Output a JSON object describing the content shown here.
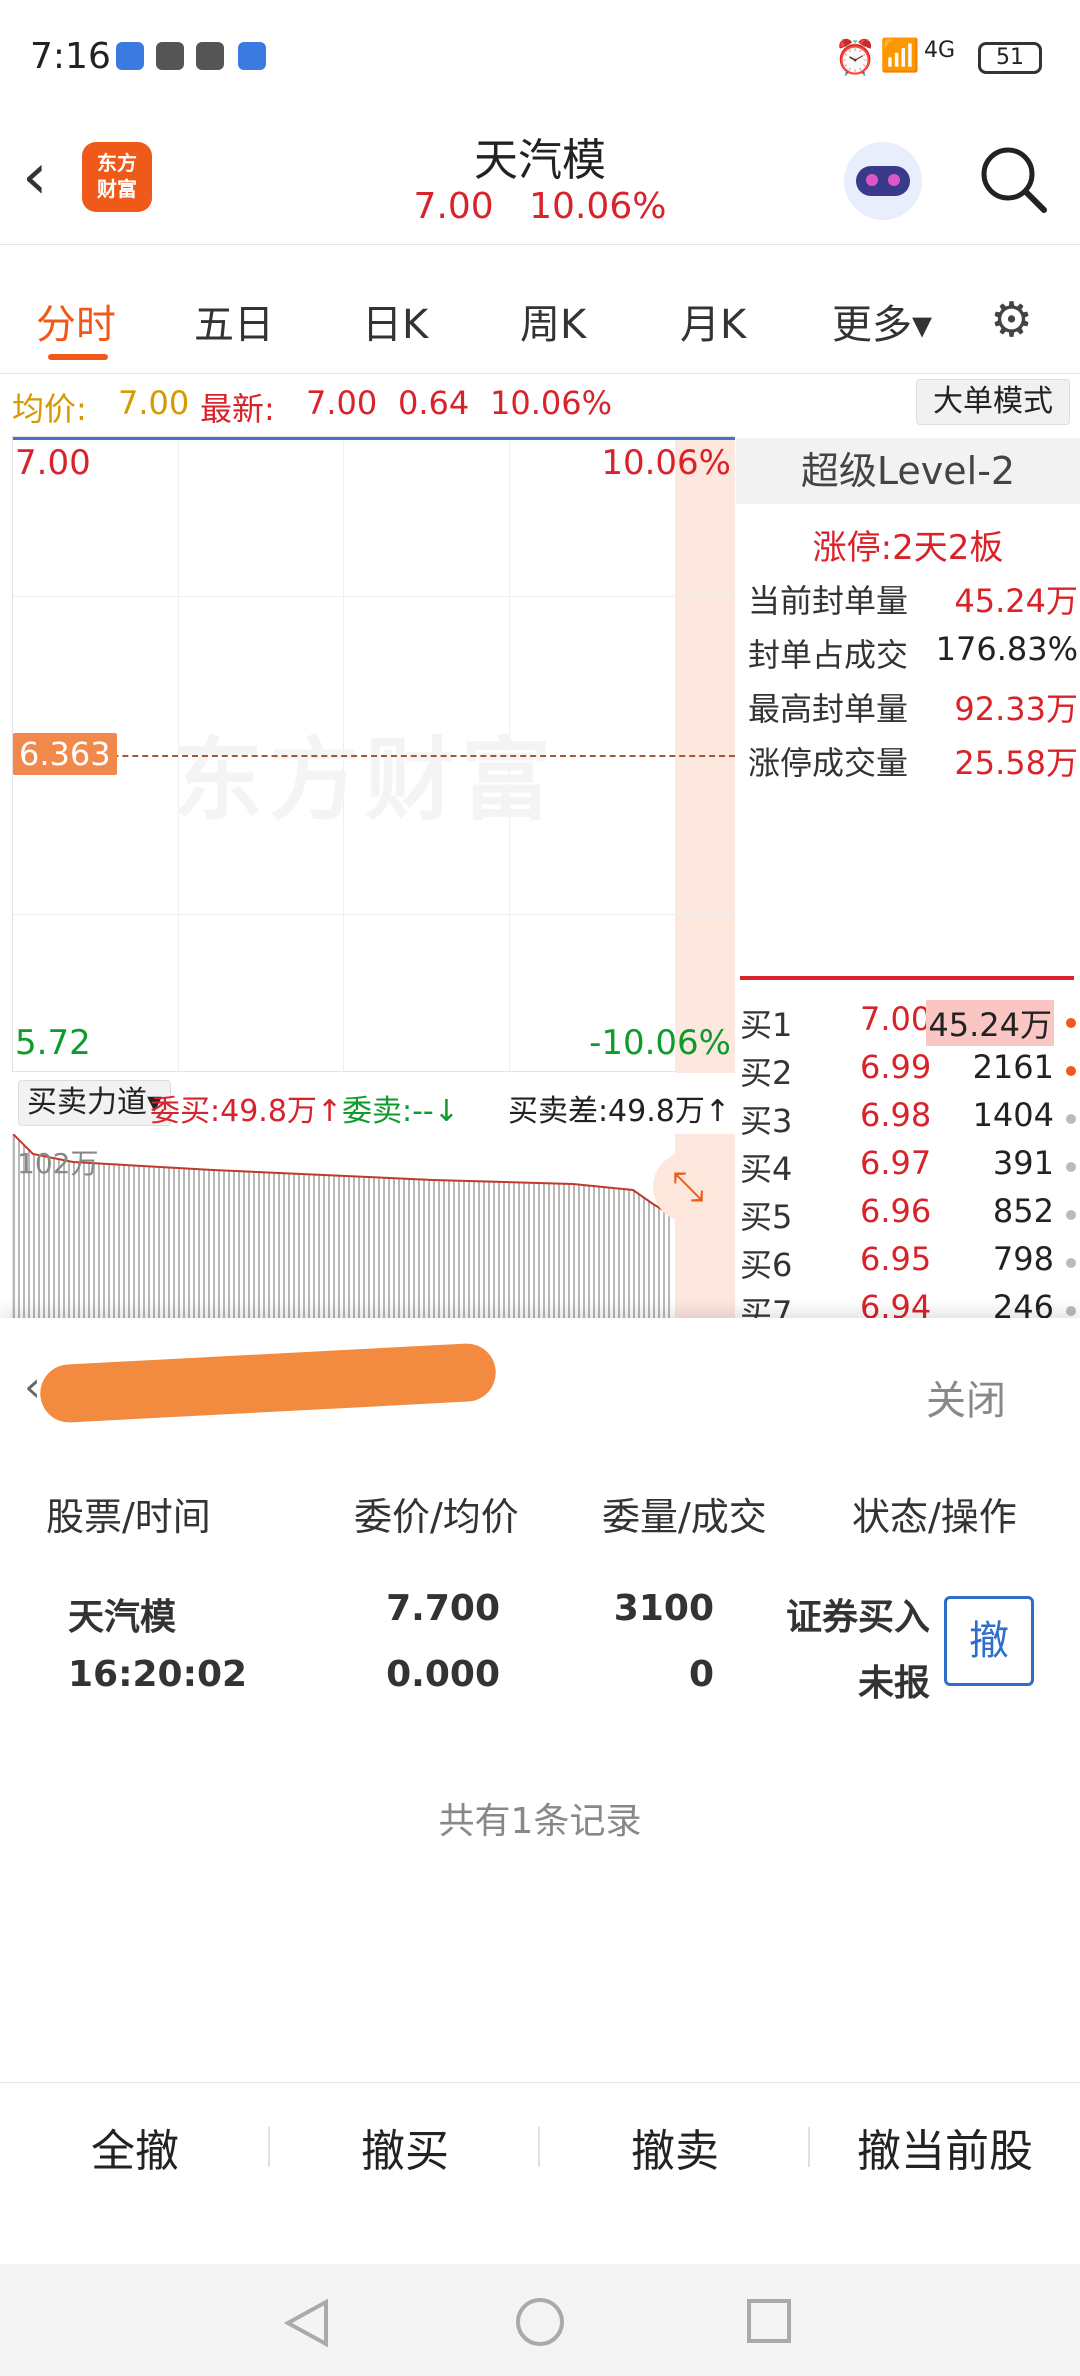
{
  "status": {
    "time": "7:16",
    "battery": "51",
    "net": "4G"
  },
  "header": {
    "title": "天汽模",
    "price": "7.00",
    "change_pct": "10.06%",
    "logo_line1": "东方",
    "logo_line2": "财富"
  },
  "tabs": [
    {
      "label": "分时"
    },
    {
      "label": "五日"
    },
    {
      "label": "日K"
    },
    {
      "label": "周K"
    },
    {
      "label": "月K"
    },
    {
      "label": "更多▾"
    }
  ],
  "info": {
    "avg_label": "均价:",
    "avg_value": "7.00",
    "latest_label": "最新:",
    "latest_value": "7.00",
    "change": "0.64",
    "change_pct": "10.06%",
    "mode_button": "大单模式"
  },
  "chart": {
    "top_price": "7.00",
    "top_pct": "10.06%",
    "mid_price": "6.363",
    "bottom_price": "5.72",
    "bottom_pct": "-10.06%",
    "watermark": "东方财富"
  },
  "level2": {
    "title": "超级Level-2",
    "limit_label": "涨停:",
    "limit_value": "2天2板",
    "rows": [
      {
        "label": "当前封单量",
        "value": "45.24万"
      },
      {
        "label": "封单占成交",
        "value": "176.83%"
      },
      {
        "label": "最高封单量",
        "value": "92.33万"
      },
      {
        "label": "涨停成交量",
        "value": "25.58万"
      }
    ],
    "bids": [
      {
        "name": "买1",
        "price": "7.00",
        "qty": "45.24万"
      },
      {
        "name": "买2",
        "price": "6.99",
        "qty": "2161"
      },
      {
        "name": "买3",
        "price": "6.98",
        "qty": "1404"
      },
      {
        "name": "买4",
        "price": "6.97",
        "qty": "391"
      },
      {
        "name": "买5",
        "price": "6.96",
        "qty": "852"
      },
      {
        "name": "买6",
        "price": "6.95",
        "qty": "798"
      },
      {
        "name": "买7",
        "price": "6.94",
        "qty": "246"
      }
    ]
  },
  "power": {
    "chip": "买卖力道▾",
    "buy": "委买:49.8万↑",
    "sell": "委卖:--↓",
    "diff": "买卖差:49.8万↑",
    "vol_max": "102万"
  },
  "sheet": {
    "close": "关闭",
    "col_headers": [
      "股票/时间",
      "委价/均价",
      "委量/成交",
      "状态/操作"
    ],
    "order": {
      "stock": "天汽模",
      "time": "16:20:02",
      "price": "7.700",
      "avg": "0.000",
      "qty": "3100",
      "filled": "0",
      "action": "证券买入",
      "status": "未报",
      "cancel": "撤"
    },
    "records": "共有1条记录",
    "buttons": [
      "全撤",
      "撤买",
      "撤卖",
      "撤当前股"
    ]
  }
}
